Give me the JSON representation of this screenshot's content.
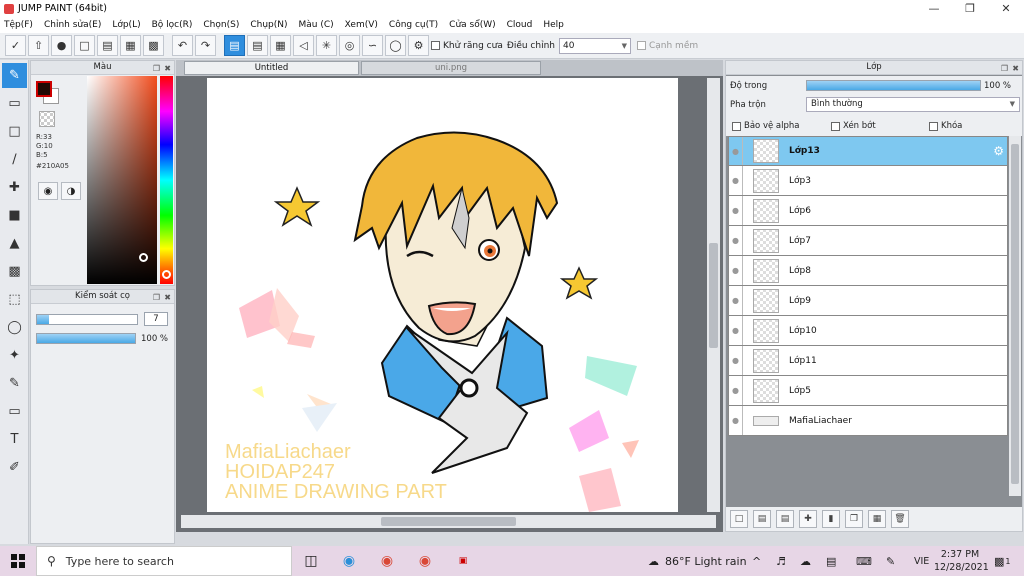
{
  "window": {
    "title": "JUMP PAINT (64bit)"
  },
  "menu": [
    "Tệp(F)",
    "Chỉnh sửa(E)",
    "Lớp(L)",
    "Bộ lọc(R)",
    "Chọn(S)",
    "Chụp(N)",
    "Màu (C)",
    "Xem(V)",
    "Công cụ(T)",
    "Cửa sổ(W)",
    "Cloud",
    "Help"
  ],
  "toolbar": {
    "antialias_label": "Khử răng cưa",
    "adjust_label": "Điều chỉnh",
    "adjust_value": "40",
    "snap_label": "Cạnh mềm"
  },
  "color_panel": {
    "title": "Màu",
    "r": "R:33",
    "g": "G:10",
    "b": "B:5",
    "hex": "#210A05",
    "fg_color": "#210A05"
  },
  "brush_panel": {
    "title": "Kiểm soát cọ",
    "size": "7",
    "opacity": "100 %",
    "size_fraction": 0.03,
    "opacity_fraction": 1.0
  },
  "tabs": [
    "Untitled",
    "uni.png"
  ],
  "canvas": {
    "text_lines": [
      "MafiaLiachaer",
      "HOIDAP247",
      "ANIME DRAWING PART"
    ],
    "text_color": "#f7d98a"
  },
  "layer_panel": {
    "title": "Lớp",
    "opacity_label": "Độ trong",
    "opacity_value": "100 %",
    "blend_label": "Pha trộn",
    "blend_value": "Bình thường",
    "protect_alpha": "Bảo vệ alpha",
    "clip": "Xén bớt",
    "lock": "Khóa",
    "layers": [
      {
        "name": "Lớp13",
        "selected": true
      },
      {
        "name": "Lớp3"
      },
      {
        "name": "Lớp6"
      },
      {
        "name": "Lớp7"
      },
      {
        "name": "Lớp8"
      },
      {
        "name": "Lớp9"
      },
      {
        "name": "Lớp10"
      },
      {
        "name": "Lớp11"
      },
      {
        "name": "Lớp5"
      },
      {
        "name": "MafiaLiachaer"
      }
    ]
  },
  "taskbar": {
    "search_placeholder": "Type here to search",
    "weather": "86°F  Light rain",
    "lang": "VIE",
    "time": "2:37 PM",
    "date": "12/28/2021",
    "notifications": "1"
  }
}
